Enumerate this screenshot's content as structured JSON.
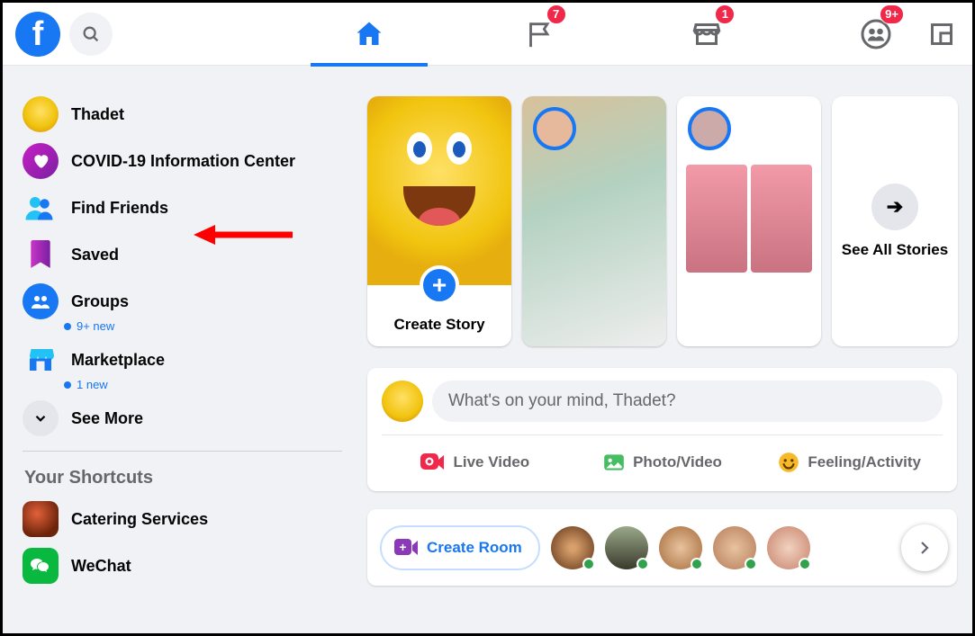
{
  "topnav": {
    "badges": {
      "watch": "7",
      "marketplace": "1",
      "groups": "9+"
    }
  },
  "sidebar": {
    "profile_name": "Thadet",
    "covid_label": "COVID-19 Information Center",
    "find_friends_label": "Find Friends",
    "saved_label": "Saved",
    "groups_label": "Groups",
    "groups_sub": "9+ new",
    "marketplace_label": "Marketplace",
    "marketplace_sub": "1 new",
    "see_more_label": "See More",
    "shortcuts_title": "Your Shortcuts",
    "shortcut1": "Catering Services",
    "shortcut2": "WeChat"
  },
  "stories": {
    "create_label": "Create Story",
    "see_all_label": "See All Stories"
  },
  "composer": {
    "placeholder": "What's on your mind, Thadet?",
    "live_label": "Live Video",
    "photo_label": "Photo/Video",
    "feeling_label": "Feeling/Activity"
  },
  "rooms": {
    "create_label": "Create Room"
  }
}
